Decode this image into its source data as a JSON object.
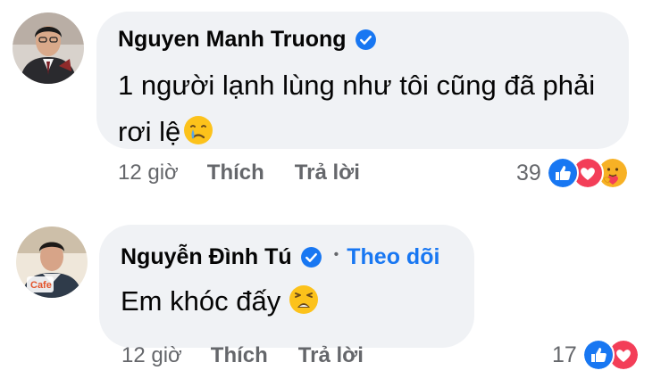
{
  "comments": [
    {
      "author": "Nguyen Manh Truong",
      "verified": true,
      "follow_label": "",
      "text_lines": [
        "1 người lạnh lùng như tôi cũng đã phải",
        "rơi lệ"
      ],
      "emoji": "crying-face",
      "time": "12 giờ",
      "like_label": "Thích",
      "reply_label": "Trả lời",
      "reaction_count": "39",
      "reactions": [
        "like",
        "love",
        "care"
      ]
    },
    {
      "author": "Nguyễn Đình Tú",
      "verified": true,
      "dot": "•",
      "follow_label": "Theo dõi",
      "text_lines": [
        "Em khóc đấy"
      ],
      "emoji": "weary-face",
      "time": "12 giờ",
      "like_label": "Thích",
      "reply_label": "Trả lời",
      "reaction_count": "17",
      "reactions": [
        "like",
        "love"
      ]
    }
  ],
  "colors": {
    "bubble": "#f0f2f5",
    "text": "#050505",
    "secondary": "#65676b",
    "link": "#1877f2",
    "like": "#1877f2",
    "love": "#f33e58",
    "care": "#f7b125"
  }
}
